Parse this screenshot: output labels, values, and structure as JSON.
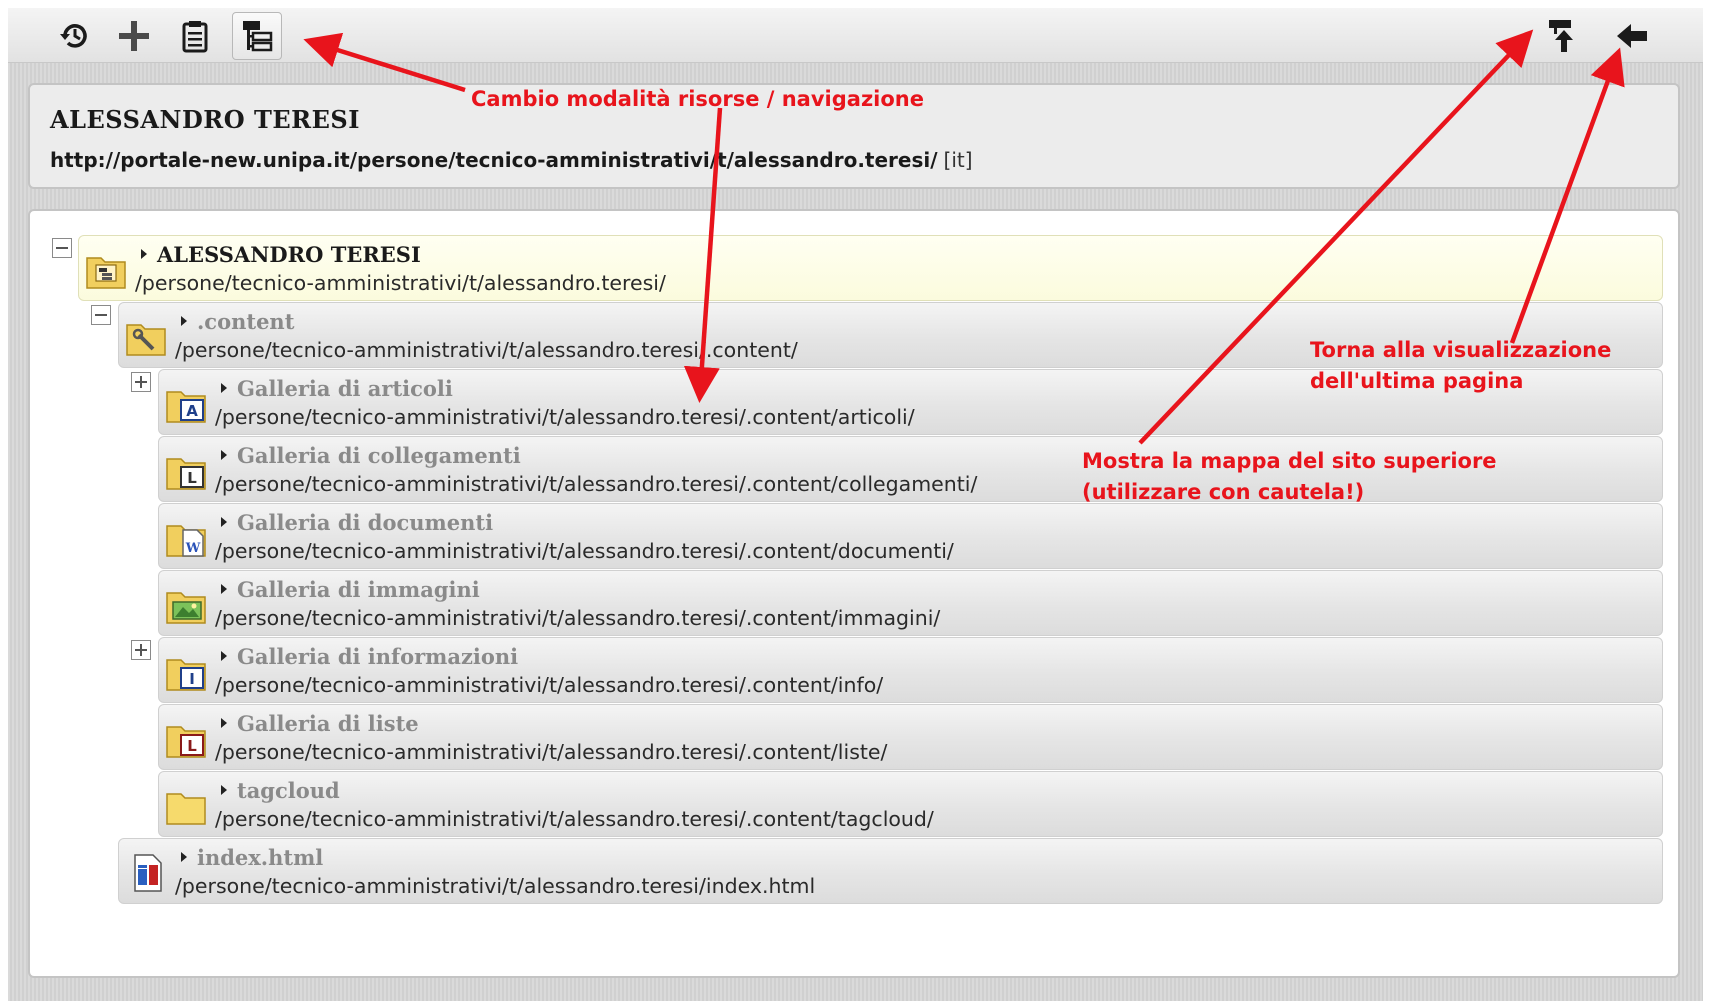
{
  "toolbar": {
    "buttons": [
      {
        "name": "history-icon"
      },
      {
        "name": "add-icon"
      },
      {
        "name": "clipboard-icon"
      },
      {
        "name": "sitemap-toggle-icon"
      },
      {
        "name": "parent-sitemap-icon"
      },
      {
        "name": "back-arrow-icon"
      }
    ]
  },
  "header": {
    "title": "ALESSANDRO TERESI",
    "url": "http://portale-new.unipa.it/persone/tecnico-amministrativi/t/alessandro.teresi/",
    "lang": "[it]"
  },
  "tree": {
    "root": {
      "title": "ALESSANDRO TERESI",
      "path": "/persone/tecnico-amministrativi/t/alessandro.teresi/",
      "icon": "root-folder-icon"
    },
    "content": {
      "title": ".content",
      "path": "/persone/tecnico-amministrativi/t/alessandro.teresi/.content/",
      "icon": "config-folder-icon"
    },
    "children": [
      {
        "title": "Galleria di articoli",
        "path": "/persone/tecnico-amministrativi/t/alessandro.teresi/.content/articoli/",
        "icon": "article-folder-icon",
        "expander": "plus"
      },
      {
        "title": "Galleria di collegamenti",
        "path": "/persone/tecnico-amministrativi/t/alessandro.teresi/.content/collegamenti/",
        "icon": "link-folder-icon",
        "expander": ""
      },
      {
        "title": "Galleria di documenti",
        "path": "/persone/tecnico-amministrativi/t/alessandro.teresi/.content/documenti/",
        "icon": "document-folder-icon",
        "expander": ""
      },
      {
        "title": "Galleria di immagini",
        "path": "/persone/tecnico-amministrativi/t/alessandro.teresi/.content/immagini/",
        "icon": "image-folder-icon",
        "expander": ""
      },
      {
        "title": "Galleria di informazioni",
        "path": "/persone/tecnico-amministrativi/t/alessandro.teresi/.content/info/",
        "icon": "info-folder-icon",
        "expander": "plus"
      },
      {
        "title": "Galleria di liste",
        "path": "/persone/tecnico-amministrativi/t/alessandro.teresi/.content/liste/",
        "icon": "list-folder-icon",
        "expander": ""
      },
      {
        "title": "tagcloud",
        "path": "/persone/tecnico-amministrativi/t/alessandro.teresi/.content/tagcloud/",
        "icon": "plain-folder-icon",
        "expander": ""
      }
    ],
    "index": {
      "title": "index.html",
      "path": "/persone/tecnico-amministrativi/t/alessandro.teresi/index.html",
      "icon": "html-page-icon"
    }
  },
  "annotations": {
    "mode_switch": "Cambio modalità risorse / navigazione",
    "back_line1": "Torna alla visualizzazione",
    "back_line2": "dell'ultima pagina",
    "parent_line1": "Mostra la mappa del sito superiore",
    "parent_line2": "(utilizzare con cautela!)"
  },
  "colors": {
    "annotation": "#e8141c",
    "selected_row": "#fbfbdd",
    "row": "#e5e5e5"
  }
}
